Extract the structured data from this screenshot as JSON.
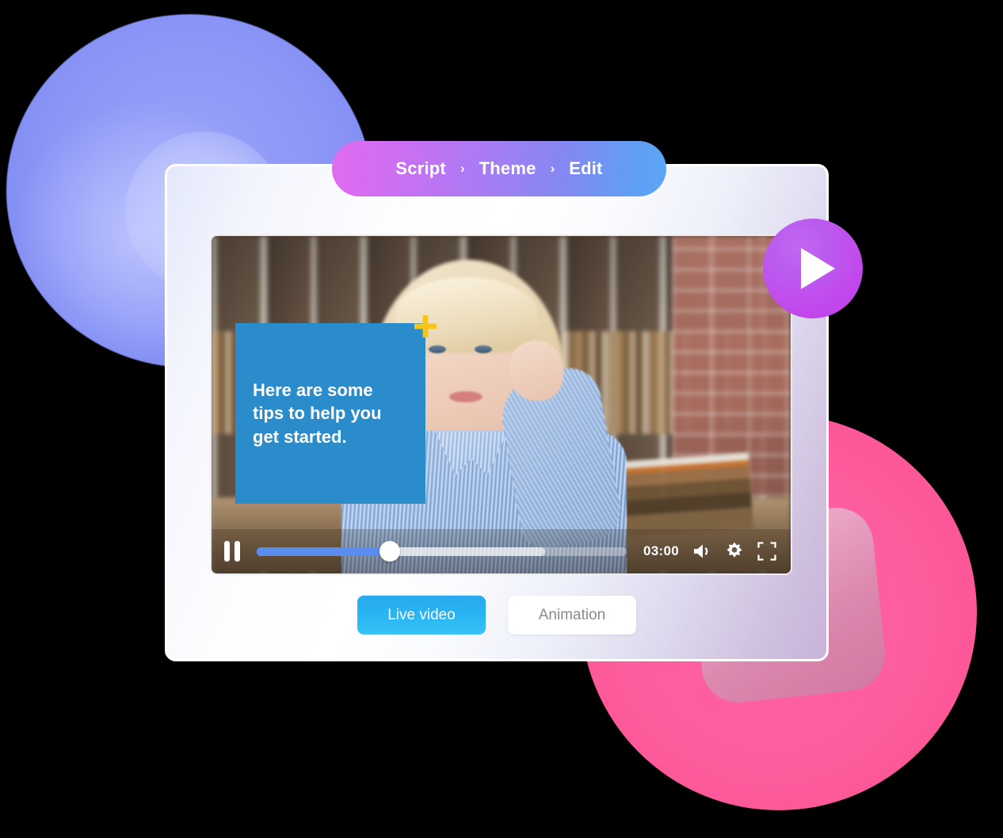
{
  "breadcrumb": {
    "steps": [
      {
        "label": "Script"
      },
      {
        "label": "Theme"
      },
      {
        "label": "Edit"
      }
    ],
    "separator": "›"
  },
  "video": {
    "caption_text": "Here are some\ntips to help you\nget started.",
    "caption_bg_color": "#2b8ccc",
    "plus_icon_color": "#f5c518",
    "plus_icon_name": "plus-icon",
    "scene_description": "Young woman with blonde hair in a blue striped shirt seated in front of a white bookshelf",
    "controls": {
      "pause_icon_name": "pause-icon",
      "time_elapsed": "03:00",
      "progress_percent": 36,
      "buffered_percent": 78,
      "volume_icon_name": "volume-icon",
      "settings_icon_name": "gear-icon",
      "fullscreen_icon_name": "fullscreen-icon"
    }
  },
  "modes": {
    "live_label": "Live video",
    "animation_label": "Animation",
    "active": "Live video",
    "active_color": "#28b5f2",
    "inactive_text_color": "#8a8a8a"
  },
  "play_button": {
    "icon_name": "play-icon",
    "color": "#c14ded"
  },
  "decor": {
    "purple_blob_color": "#8b95f6",
    "pink_blob_color": "#fd5d9e",
    "pink_square_color": "#d98bb0"
  }
}
